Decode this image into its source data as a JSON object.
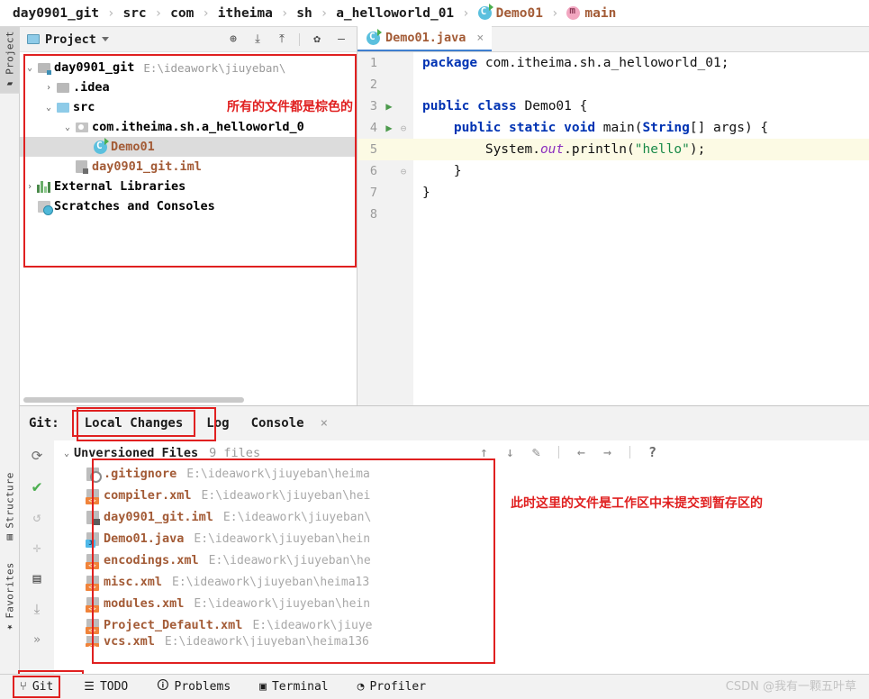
{
  "breadcrumb": [
    {
      "label": "day0901_git",
      "icon": "none",
      "style": "plain"
    },
    {
      "label": "src",
      "icon": "none",
      "style": "plain"
    },
    {
      "label": "com",
      "icon": "none",
      "style": "plain"
    },
    {
      "label": "itheima",
      "icon": "none",
      "style": "plain"
    },
    {
      "label": "sh",
      "icon": "none",
      "style": "plain"
    },
    {
      "label": "a_helloworld_01",
      "icon": "none",
      "style": "plain"
    },
    {
      "label": "Demo01",
      "icon": "class-icon",
      "style": "brown"
    },
    {
      "label": "main",
      "icon": "method-icon",
      "style": "brown"
    }
  ],
  "breadcrumb_separator": "›",
  "rail": {
    "top": [
      {
        "label": "Project",
        "icon": "folder-icon",
        "active": true
      }
    ],
    "bottom": [
      {
        "label": "Structure",
        "icon": "structure-icon",
        "active": false
      },
      {
        "label": "Favorites",
        "icon": "star-icon",
        "active": false
      }
    ]
  },
  "project_panel": {
    "title": "Project",
    "tools": [
      "locate-icon",
      "expand-all-icon",
      "collapse-all-icon",
      "settings-gear-icon",
      "minimize-icon"
    ],
    "tree": [
      {
        "indent": 0,
        "arrow": "⌄",
        "icon": "project-folder-icon",
        "name": "day0901_git",
        "color": "black",
        "path": "E:\\ideawork\\jiuyeban\\",
        "selected": false
      },
      {
        "indent": 1,
        "arrow": "›",
        "icon": "folder-icon",
        "name": ".idea",
        "color": "black",
        "path": "",
        "selected": false
      },
      {
        "indent": 1,
        "arrow": "⌄",
        "icon": "source-folder-icon",
        "name": "src",
        "color": "black",
        "path": "",
        "selected": false
      },
      {
        "indent": 2,
        "arrow": "⌄",
        "icon": "package-icon",
        "name": "com.itheima.sh.a_helloworld_0",
        "color": "black",
        "path": "",
        "selected": false
      },
      {
        "indent": 3,
        "arrow": "",
        "icon": "class-icon",
        "name": "Demo01",
        "color": "brown",
        "path": "",
        "selected": true
      },
      {
        "indent": 2,
        "arrow": "",
        "icon": "iml-icon",
        "name": "day0901_git.iml",
        "color": "brown",
        "path": "",
        "selected": false
      },
      {
        "indent": 0,
        "arrow": "›",
        "icon": "library-icon",
        "name": "External Libraries",
        "color": "black",
        "path": "",
        "selected": false
      },
      {
        "indent": 0,
        "arrow": "",
        "icon": "scratches-icon",
        "name": "Scratches and Consoles",
        "color": "black",
        "path": "",
        "selected": false
      }
    ],
    "annotation": "所有的文件都是棕色的"
  },
  "editor": {
    "tab": {
      "label": "Demo01.java",
      "icon": "class-icon",
      "close": "×"
    },
    "lines": [
      {
        "num": "1",
        "run": false,
        "fold": "",
        "highlight": false,
        "tokens": [
          {
            "t": "package ",
            "c": "kw"
          },
          {
            "t": "com.itheima.sh.a_helloworld_01;",
            "c": "pl"
          }
        ]
      },
      {
        "num": "2",
        "run": false,
        "fold": "",
        "highlight": false,
        "tokens": []
      },
      {
        "num": "3",
        "run": true,
        "fold": "",
        "highlight": false,
        "tokens": [
          {
            "t": "public class ",
            "c": "kw"
          },
          {
            "t": "Demo01 {",
            "c": "pl"
          }
        ]
      },
      {
        "num": "4",
        "run": true,
        "fold": "⊖",
        "highlight": false,
        "tokens": [
          {
            "t": "    public static void ",
            "c": "kw"
          },
          {
            "t": "main",
            "c": "pl"
          },
          {
            "t": "(",
            "c": "pl"
          },
          {
            "t": "String",
            "c": "kw"
          },
          {
            "t": "[] args) {",
            "c": "pl"
          }
        ]
      },
      {
        "num": "5",
        "run": false,
        "fold": "",
        "highlight": true,
        "tokens": [
          {
            "t": "        System.",
            "c": "pl"
          },
          {
            "t": "out",
            "c": "stat"
          },
          {
            "t": ".println(",
            "c": "pl"
          },
          {
            "t": "\"hello\"",
            "c": "str"
          },
          {
            "t": ");",
            "c": "pl"
          }
        ]
      },
      {
        "num": "6",
        "run": false,
        "fold": "⊖",
        "highlight": false,
        "tokens": [
          {
            "t": "    }",
            "c": "pl"
          }
        ]
      },
      {
        "num": "7",
        "run": false,
        "fold": "",
        "highlight": false,
        "tokens": [
          {
            "t": "}",
            "c": "pl"
          }
        ]
      },
      {
        "num": "8",
        "run": false,
        "fold": "",
        "highlight": false,
        "tokens": []
      }
    ]
  },
  "git_panel": {
    "label": "Git:",
    "tabs": [
      {
        "label": "Local Changes",
        "active": true,
        "boxed": true
      },
      {
        "label": "Log",
        "active": false,
        "boxed": false
      },
      {
        "label": "Console",
        "active": false,
        "boxed": false
      }
    ],
    "close": "×",
    "rail_icons": [
      "refresh-icon",
      "commit-check-icon",
      "rollback-icon",
      "collapse-icon",
      "shelve-icon",
      "download-icon",
      "more-icon"
    ],
    "right_tools": [
      "arrow-up-icon",
      "arrow-down-icon",
      "edit-pencil-icon",
      "arrow-left-icon",
      "arrow-right-icon",
      "help-icon"
    ],
    "group": {
      "arrow": "⌄",
      "title": "Unversioned Files",
      "count": "9 files"
    },
    "files": [
      {
        "icon": "gitignore-icon",
        "name": ".gitignore",
        "path": "E:\\ideawork\\jiuyeban\\heima"
      },
      {
        "icon": "xml-icon",
        "name": "compiler.xml",
        "path": "E:\\ideawork\\jiuyeban\\hei"
      },
      {
        "icon": "iml-icon",
        "name": "day0901_git.iml",
        "path": "E:\\ideawork\\jiuyeban\\"
      },
      {
        "icon": "java-icon",
        "name": "Demo01.java",
        "path": "E:\\ideawork\\jiuyeban\\hein"
      },
      {
        "icon": "xml-icon",
        "name": "encodings.xml",
        "path": "E:\\ideawork\\jiuyeban\\he"
      },
      {
        "icon": "xml-icon",
        "name": "misc.xml",
        "path": "E:\\ideawork\\jiuyeban\\heima13"
      },
      {
        "icon": "xml-icon",
        "name": "modules.xml",
        "path": "E:\\ideawork\\jiuyeban\\hein"
      },
      {
        "icon": "xml-icon",
        "name": "Project_Default.xml",
        "path": "E:\\ideawork\\jiuye"
      },
      {
        "icon": "xml-icon",
        "name": "vcs.xml",
        "path": "E:\\ideawork\\jiuyeban\\heima136"
      }
    ],
    "annotation": "此时这里的文件是工作区中未提交到暂存区的"
  },
  "statusbar": {
    "items": [
      {
        "label": "Git",
        "icon": "git-branch-icon",
        "boxed": true
      },
      {
        "label": "TODO",
        "icon": "todo-list-icon",
        "boxed": false
      },
      {
        "label": "Problems",
        "icon": "problems-info-icon",
        "boxed": false
      },
      {
        "label": "Terminal",
        "icon": "terminal-icon",
        "boxed": false
      },
      {
        "label": "Profiler",
        "icon": "profiler-icon",
        "boxed": false
      }
    ]
  },
  "watermark": "CSDN @我有一颗五叶草",
  "colors": {
    "brown_file": "#a35b36",
    "annotation_red": "#e02020",
    "keyword_blue": "#0033b3",
    "string_green": "#198a48",
    "static_purple": "#8b2fbf",
    "tab_underline": "#3f7fd0",
    "current_line": "#fcfae4",
    "selection_gray": "#dcdcdc"
  }
}
